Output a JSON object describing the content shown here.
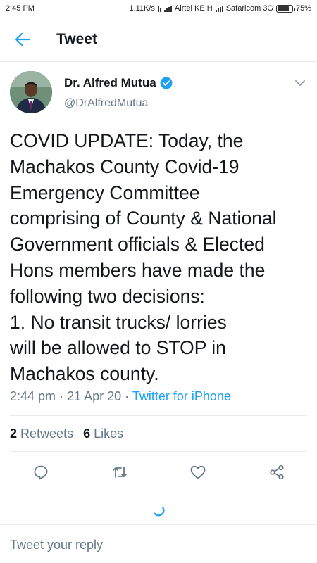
{
  "status_bar": {
    "time": "2:45 PM",
    "network_speed": "1.11K/s",
    "carrier1": "Airtel KE H",
    "carrier2": "Safaricom 3G",
    "battery_text": "75%",
    "battery_level": 0.75
  },
  "header": {
    "title": "Tweet"
  },
  "tweet": {
    "author_name": "Dr. Alfred Mutua",
    "handle": "@DrAlfredMutua",
    "text": "COVID UPDATE: Today, the\nMachakos County Covid-19\nEmergency Committee\ncomprising of County & National\nGovernment officials & Elected\nHons members have made the\nfollowing two decisions:\n1. No transit trucks/ lorries\nwill be allowed to STOP in\nMachakos county.",
    "time": "2:44 pm",
    "date": "21 Apr 20",
    "source": "Twitter for iPhone",
    "retweets_count": "2",
    "retweets_label": "Retweets",
    "likes_count": "6",
    "likes_label": "Likes"
  },
  "reply": {
    "placeholder": "Tweet your reply"
  },
  "colors": {
    "accent": "#1da1f2",
    "muted": "#657786",
    "divider": "#e6ecf0"
  },
  "icons": [
    "back-arrow-icon",
    "verified-badge-icon",
    "chevron-down-icon",
    "reply-icon",
    "retweet-icon",
    "like-icon",
    "share-icon",
    "loading-spinner-icon"
  ]
}
